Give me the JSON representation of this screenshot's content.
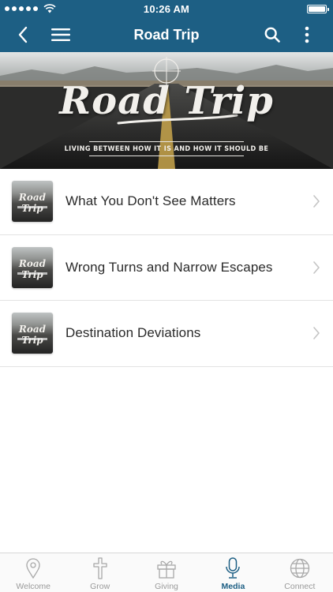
{
  "status_bar": {
    "time": "10:26 AM"
  },
  "nav": {
    "title": "Road Trip"
  },
  "banner": {
    "title": "Road Trip",
    "subtitle": "LIVING BETWEEN HOW IT IS AND HOW IT SHOULD BE"
  },
  "episodes": [
    {
      "title": "What You Don't See Matters",
      "thumb_title": "Road Trip"
    },
    {
      "title": "Wrong Turns and Narrow Escapes",
      "thumb_title": "Road Trip"
    },
    {
      "title": "Destination Deviations",
      "thumb_title": "Road Trip"
    }
  ],
  "tabs": [
    {
      "label": "Welcome",
      "icon": "map-pin-icon",
      "active": false
    },
    {
      "label": "Grow",
      "icon": "cross-icon",
      "active": false
    },
    {
      "label": "Giving",
      "icon": "gift-icon",
      "active": false
    },
    {
      "label": "Media",
      "icon": "microphone-icon",
      "active": true
    },
    {
      "label": "Connect",
      "icon": "globe-icon",
      "active": false
    }
  ],
  "colors": {
    "accent": "#1d5f84",
    "tab_inactive": "#9a9a9a"
  }
}
